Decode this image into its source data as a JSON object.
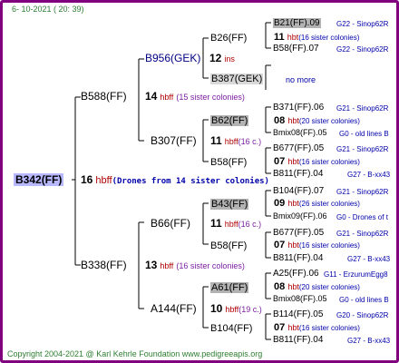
{
  "header": {
    "date": "6- 10-2021 ( 20: 39)"
  },
  "footer": {
    "text": "Copyright 2004-2021 @ Karl Kehrle Foundation    www.pedigreeapis.org"
  },
  "root": {
    "name": "B342(FF)",
    "count": "16",
    "hbff": "hbff",
    "sisters": "(Drones from 14 sister colonies)"
  },
  "gen1": [
    {
      "name": "B588(FF)",
      "count": "14",
      "hbff": "hbff",
      "sisters": "(15 sister colonies)"
    },
    {
      "name": "B338(FF)",
      "count": "13",
      "hbff": "hbff",
      "sisters": "(16 sister colonies)"
    }
  ],
  "gen2": [
    {
      "name": "B956(GEK)",
      "count": "12",
      "note": "ins"
    },
    {
      "name": "B307(FF)",
      "count": "11",
      "hbff": "hbff",
      "sisters": "(16 c.)"
    },
    {
      "name": "B66(FF)",
      "count": "11",
      "hbff": "hbff",
      "sisters": "(16 c.)"
    },
    {
      "name": "A144(FF)",
      "count": "10",
      "hbff": "hbff",
      "sisters": "(19 c.)"
    }
  ],
  "gen3": [
    {
      "name": "B26(FF)",
      "count": "11",
      "hbt": "hbt",
      "sisters": "(16 sister colonies)"
    },
    {
      "name": "B387(GEK)",
      "note": "no more"
    },
    {
      "name": "B62(FF)",
      "count": "08",
      "hbt": "hbt",
      "sisters": "(20 sister colonies)"
    },
    {
      "name": "B58(FF)",
      "count": "07",
      "hbt": "hbt",
      "sisters": "(16 sister colonies)"
    },
    {
      "name": "B43(FF)",
      "count": "09",
      "hbt": "hbt",
      "sisters": "(26 sister colonies)"
    },
    {
      "name": "B58(FF)",
      "count": "07",
      "hbt": "hbt",
      "sisters": "(16 sister colonies)"
    },
    {
      "name": "A61(FF)",
      "count": "08",
      "hbt": "hbt",
      "sisters": "(20 sister colonies)"
    },
    {
      "name": "B104(FF)",
      "count": "07",
      "hbt": "hbt",
      "sisters": "(16 sister colonies)"
    }
  ],
  "gen4": [
    {
      "name": "B21(FF).09",
      "origin": "G22 - Sinop62R"
    },
    {
      "name": "B58(FF).07",
      "origin": "G22 - Sinop62R"
    },
    {
      "name": "B371(FF).06",
      "origin": "G21 - Sinop62R"
    },
    {
      "name": "Bmix08(FF).05",
      "origin": "G0 - old lines B"
    },
    {
      "name": "B677(FF).05",
      "origin": "G21 - Sinop62R"
    },
    {
      "name": "B811(FF).04",
      "origin": "G27 - B-xx43"
    },
    {
      "name": "B104(FF).07",
      "origin": "G21 - Sinop62R"
    },
    {
      "name": "Bmix09(FF).06",
      "origin": "G0 - Drones of t"
    },
    {
      "name": "B677(FF).05",
      "origin": "G21 - Sinop62R"
    },
    {
      "name": "B811(FF).04",
      "origin": "G27 - B-xx43"
    },
    {
      "name": "A25(FF).06",
      "origin": "G11 - ErzurumEgg8"
    },
    {
      "name": "Bmix08(FF).05",
      "origin": "G0 - old lines B"
    },
    {
      "name": "B114(FF).05",
      "origin": "G20 - Sinop62R"
    },
    {
      "name": "B811(FF).04",
      "origin": "G27 - B-xx43"
    }
  ]
}
